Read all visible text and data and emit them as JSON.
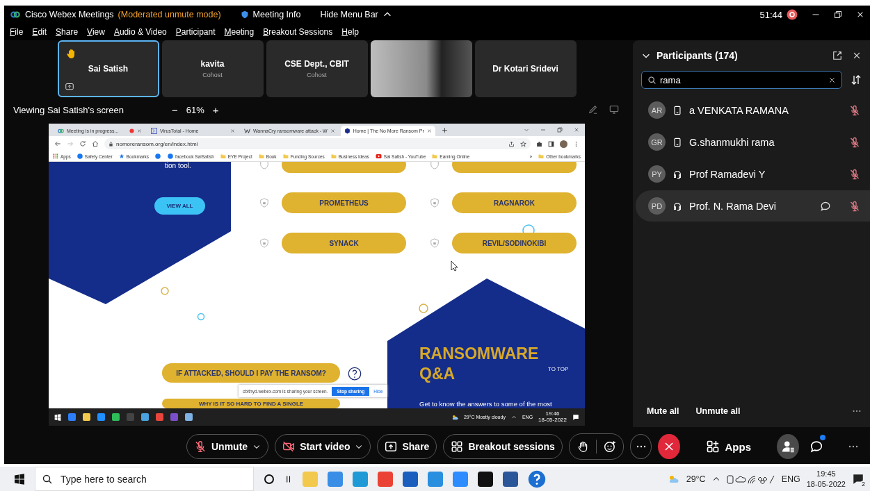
{
  "title_bar": {
    "app_name": "Cisco Webex Meetings",
    "mode": "(Moderated unmute mode)",
    "meeting_info": "Meeting Info",
    "hide_menu_bar": "Hide Menu Bar",
    "timer": "51:44",
    "recording": true
  },
  "menu": [
    "File",
    "Edit",
    "Share",
    "View",
    "Audio & Video",
    "Participant",
    "Meeting",
    "Breakout Sessions",
    "Help"
  ],
  "video_strip": [
    {
      "kind": "avatar",
      "name": "Sai Satish",
      "selected": true,
      "hand_raised": true,
      "sharing": true
    },
    {
      "kind": "avatar",
      "name": "kavita",
      "role": "Cohost",
      "selected": false,
      "hand_raised": false,
      "sharing": false
    },
    {
      "kind": "avatar",
      "name": "CSE Dept., CBIT",
      "role": "Cohost",
      "selected": false,
      "hand_raised": false,
      "sharing": false
    },
    {
      "kind": "video",
      "selected": false,
      "hand_raised": false,
      "sharing": false
    },
    {
      "kind": "avatar",
      "name": "Dr Kotari Sridevi",
      "selected": false,
      "hand_raised": false,
      "sharing": false
    }
  ],
  "share_header": {
    "viewing": "Viewing Sai Satish's screen",
    "zoom_out": "−",
    "zoom": "61%",
    "zoom_in": "+"
  },
  "shared_screen": {
    "tabs": [
      {
        "kind": "webex",
        "title": "Meeting is in progress...",
        "recording": true,
        "selected": false
      },
      {
        "kind": "virustotal",
        "title": "VirusTotal - Home",
        "recording": false,
        "selected": false
      },
      {
        "kind": "wikipedia",
        "title": "WannaCry ransomware attack - W",
        "recording": false,
        "selected": false
      },
      {
        "kind": "nomoreransom",
        "title": "Home | The No More Ransom Pr",
        "recording": false,
        "selected": true
      }
    ],
    "address": "nomoreransom.org/en/index.html",
    "bookmarks": [
      {
        "kind": "apps",
        "label": "Apps"
      },
      {
        "kind": "facebook",
        "label": "Safety Center"
      },
      {
        "kind": "star",
        "label": "Bookmarks"
      },
      {
        "kind": "facebook2",
        "label": "facebook SaiSatish"
      },
      {
        "kind": "folder",
        "label": "EYE Project"
      },
      {
        "kind": "folder",
        "label": "Book"
      },
      {
        "kind": "folder",
        "label": "Funding Sources"
      },
      {
        "kind": "folder",
        "label": "Business Ideas"
      },
      {
        "kind": "youtube",
        "label": "Sai Satish - YouTube"
      },
      {
        "kind": "folder",
        "label": "Earning Online"
      }
    ],
    "more_bookmarks": "»",
    "other_bookmarks": "Other bookmarks",
    "page": {
      "hero_text": "tion tool.",
      "view_all": "VIEW ALL",
      "decryptors": [
        "PROMETHEUS",
        "RAGNAROK",
        "SYNACK",
        "REVIL/SODINOKIBI"
      ],
      "qa_title": "RANSOMWARE Q&A",
      "to_top": "TO TOP",
      "qa_intro": "Get to know the answers to some of the most",
      "questions": [
        "IF ATTACKED, SHOULD I PAY THE RANSOM?",
        "WHY IS IT SO HARD TO FIND A SINGLE"
      ]
    },
    "share_banner": {
      "message": "cbithyd.webex.com is sharing your screen.",
      "stop": "Stop sharing",
      "hide": "Hide"
    },
    "taskbar": {
      "weather": "29°C  Mostly cloudy",
      "language": "ENG",
      "time": "19:46",
      "date": "18-05-2022"
    }
  },
  "participants": {
    "title": "Participants (174)",
    "search": "rama",
    "rows": [
      {
        "initials": "AR",
        "kind": "phone",
        "name": "a VENKATA RAMANA",
        "chat": false,
        "selected": false
      },
      {
        "initials": "GR",
        "kind": "phone",
        "name": "G.shanmukhi rama",
        "chat": false,
        "selected": false
      },
      {
        "initials": "PY",
        "kind": "headset",
        "name": "Prof Ramadevi Y",
        "chat": false,
        "selected": false
      },
      {
        "initials": "PD",
        "kind": "headset",
        "name": "Prof. N. Rama Devi",
        "chat": true,
        "selected": true
      }
    ],
    "footer": [
      "Mute all",
      "Unmute all"
    ]
  },
  "controls": [
    {
      "kind": "audio",
      "label": "Unmute",
      "dropdown": true
    },
    {
      "kind": "video",
      "label": "Start video",
      "dropdown": true
    },
    {
      "kind": "share",
      "label": "Share",
      "dropdown": false
    },
    {
      "kind": "breakout",
      "label": "Breakout sessions",
      "dropdown": false
    },
    {
      "kind": "reactions"
    },
    {
      "kind": "more"
    },
    {
      "kind": "end"
    },
    {
      "kind": "apps",
      "label": "Apps"
    },
    {
      "kind": "participants",
      "active": true
    },
    {
      "kind": "chat",
      "unread": true
    },
    {
      "kind": "more"
    }
  ],
  "taskbar": {
    "search_placeholder": "Type here to search",
    "weather": "29°C",
    "language": "ENG",
    "time": "19:45",
    "date": "18-05-2022",
    "notifications": "2"
  }
}
